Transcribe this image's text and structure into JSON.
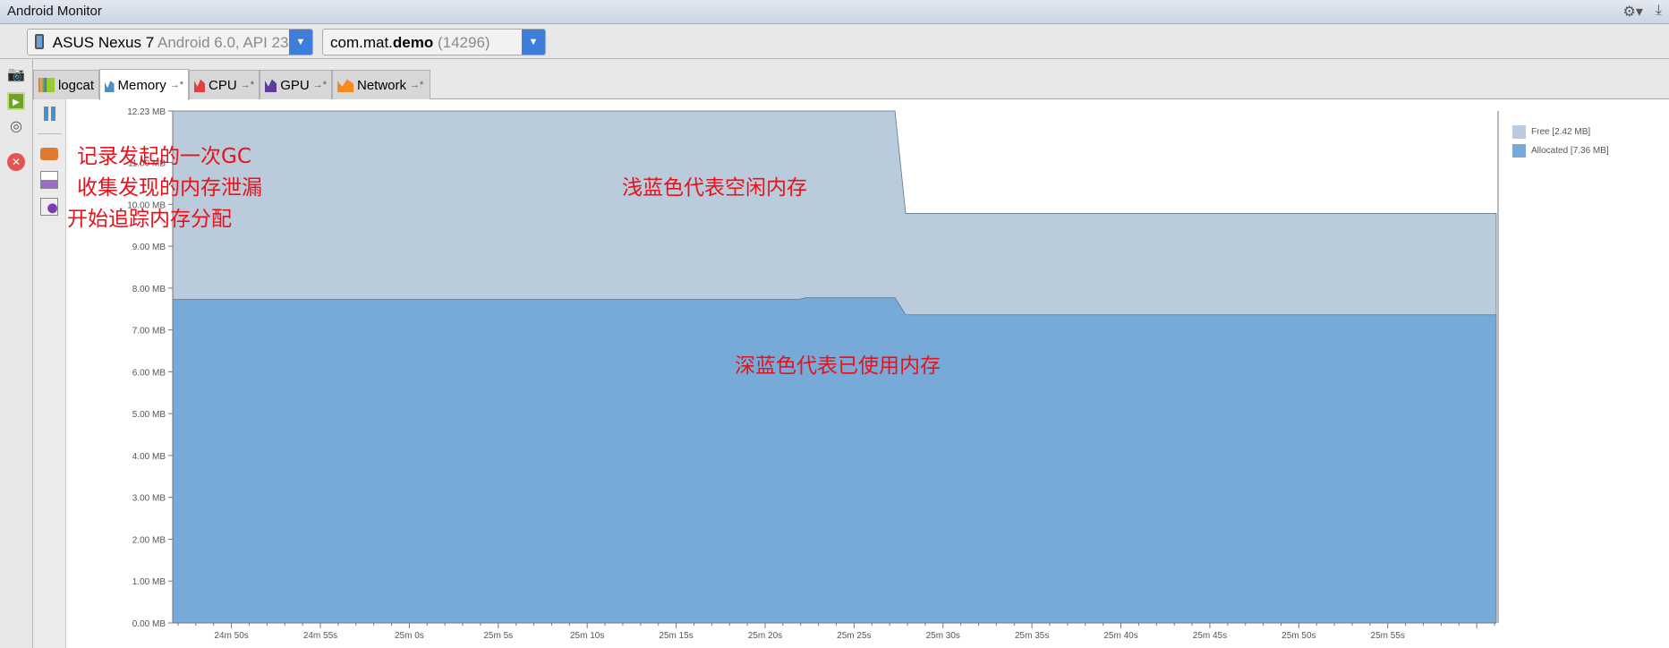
{
  "window": {
    "title": "Android Monitor",
    "icons": [
      "gear-icon",
      "download-icon"
    ]
  },
  "device": {
    "name": "ASUS Nexus 7",
    "detail": "Android 6.0, API 23"
  },
  "process": {
    "pkg_prefix": "com.mat.",
    "pkg_bold": "demo",
    "pid": "(14296)"
  },
  "tabs": [
    {
      "label": "logcat"
    },
    {
      "label": "Memory",
      "pin": "→*"
    },
    {
      "label": "CPU",
      "pin": "→*"
    },
    {
      "label": "GPU",
      "pin": "→*"
    },
    {
      "label": "Network",
      "pin": "→*"
    }
  ],
  "annotations": {
    "gc": "记录发起的一次GC",
    "leak": "收集发现的内存泄漏",
    "alloc": "开始追踪内存分配",
    "free_note": "浅蓝色代表空闲内存",
    "used_note": "深蓝色代表已使用内存"
  },
  "colors": {
    "free": "#bacbdb",
    "allocated": "#77aad8",
    "annotation": "#e8121a"
  },
  "chart_data": {
    "type": "area",
    "y_ticks": [
      "0.00 MB",
      "1.00 MB",
      "2.00 MB",
      "3.00 MB",
      "4.00 MB",
      "5.00 MB",
      "6.00 MB",
      "7.00 MB",
      "8.00 MB",
      "9.00 MB",
      "10.00 MB",
      "11.00 MB",
      "12.23 MB"
    ],
    "y_tick_values": [
      0,
      1,
      2,
      3,
      4,
      5,
      6,
      7,
      8,
      9,
      10,
      11,
      12.23
    ],
    "ylim": [
      0,
      12.23
    ],
    "x_labels": [
      "24m 50s",
      "24m 55s",
      "25m 0s",
      "25m 5s",
      "25m 10s",
      "25m 15s",
      "25m 20s",
      "25m 25s",
      "25m 30s",
      "25m 35s",
      "25m 40s",
      "25m 45s",
      "25m 50s",
      "25m 55s"
    ],
    "x_label_seconds": [
      1490,
      1495,
      1500,
      1505,
      1510,
      1515,
      1520,
      1525,
      1530,
      1535,
      1540,
      1545,
      1550,
      1555
    ],
    "xlim_seconds": [
      1486.7,
      1561.1
    ],
    "series": [
      {
        "name": "Free",
        "legend": "Free [2.42 MB]",
        "note": "total = allocated + free",
        "x": [
          1486.7,
          1527.3,
          1527.9,
          1561.1
        ],
        "total": [
          12.23,
          12.23,
          9.78,
          9.78
        ]
      },
      {
        "name": "Allocated",
        "legend": "Allocated [7.36 MB]",
        "x": [
          1486.7,
          1521.9,
          1522.3,
          1527.3,
          1527.9,
          1561.1
        ],
        "values": [
          7.73,
          7.73,
          7.77,
          7.77,
          7.36,
          7.36
        ]
      }
    ]
  }
}
